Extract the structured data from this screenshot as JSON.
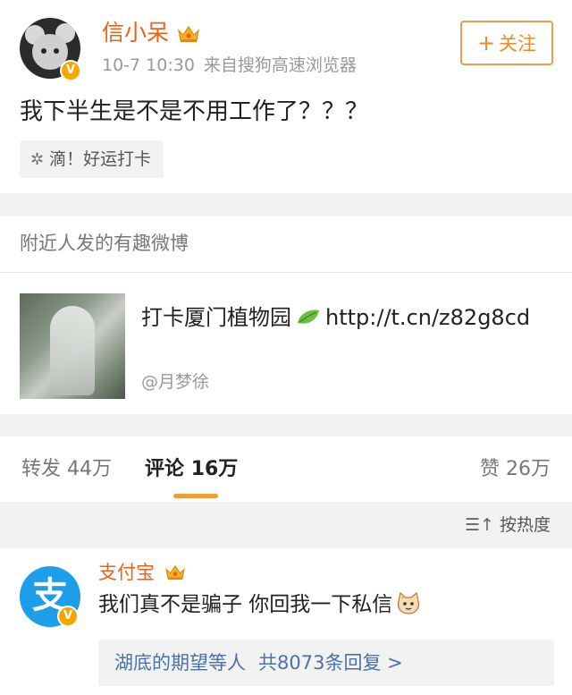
{
  "post": {
    "username": "信小呆",
    "time": "10-7 10:30",
    "source": "来自搜狗高速浏览器",
    "follow_label": "关注",
    "text": "我下半生是不是不用工作了？？？",
    "tag_label": "滴！好运打卡"
  },
  "nearby": {
    "title": "附近人发的有趣微博",
    "text": "打卡厦门植物园",
    "link": "http://t.cn/z82g8cd",
    "author": "@月梦徐"
  },
  "stats": {
    "reposts_label": "转发",
    "reposts_count": "44万",
    "comments_label": "评论",
    "comments_count": "16万",
    "likes_label": "赞",
    "likes_count": "26万"
  },
  "sort": {
    "label": "按热度"
  },
  "comment": {
    "username": "支付宝",
    "avatar_glyph": "支",
    "text": "我们真不是骗子 你回我一下私信",
    "replies_who": "湖底的期望等人",
    "replies_summary": "共8073条回复 >"
  },
  "colors": {
    "accent_orange": "#e8631a",
    "follow_orange": "#f08a2b",
    "link_blue": "#4a72a8",
    "alipay_blue": "#1d9ee8",
    "verified_badge": "#f7a600",
    "tab_indicator": "#f29d33"
  },
  "icons": {
    "verified": "verified-badge-icon",
    "crown": "crown-vip-icon",
    "tag": "sparkle-icon",
    "leaf": "leaf-icon",
    "sort": "sort-hot-icon",
    "emoji": "cat-emoji-icon"
  }
}
